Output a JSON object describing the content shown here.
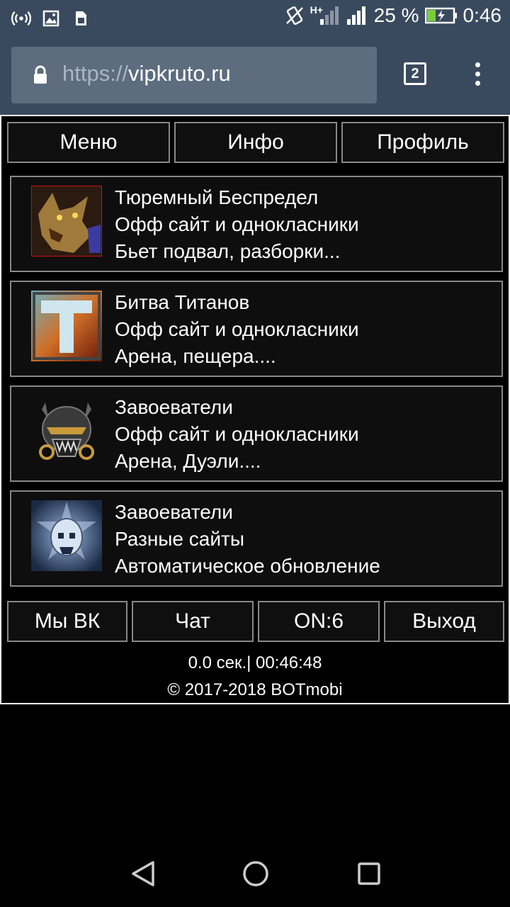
{
  "status_bar": {
    "battery_percent": "25 %",
    "time": "0:46",
    "network_type": "H+",
    "icons": [
      "hotspot-icon",
      "image-icon",
      "sim-icon",
      "vibrate-icon",
      "signal-icon",
      "battery-charging-icon"
    ]
  },
  "browser": {
    "url_protocol": "https://",
    "url_host": "vipkruto.ru",
    "tab_count": "2"
  },
  "top_nav": [
    "Меню",
    "Инфо",
    "Профиль"
  ],
  "games": [
    {
      "title": "Тюремный Беспредел",
      "line2": "Офф сайт и однокласники",
      "line3": "Бьет подвал, разборки..."
    },
    {
      "title": "Битва Титанов",
      "line2": "Офф сайт и однокласники",
      "line3": "Арена, пещера...."
    },
    {
      "title": "Завоеватели",
      "line2": "Офф сайт и однокласники",
      "line3": "Арена, Дуэли...."
    },
    {
      "title": "Завоеватели",
      "line2": "Разные сайты",
      "line3": "Автоматическое обновление"
    }
  ],
  "bottom_nav": [
    "Мы ВК",
    "Чат",
    "ON:6",
    "Выход"
  ],
  "footer": {
    "timing": "0.0 сек.| 00:46:48",
    "copyright": "© 2017-2018 BOTmobi"
  },
  "colors": {
    "chrome_bg": "#3a4a5e",
    "urlbar_bg": "#5d6c7f",
    "page_bg": "#000000",
    "border": "#888888"
  }
}
